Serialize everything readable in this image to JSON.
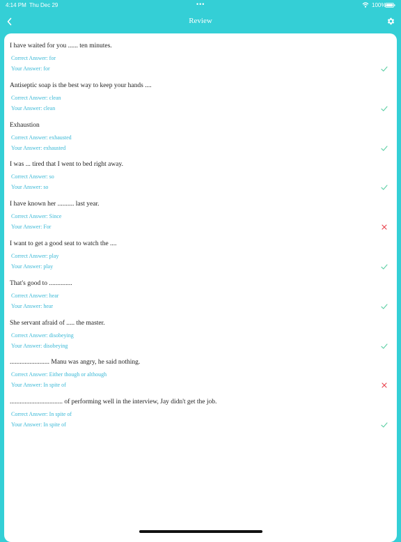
{
  "status_bar": {
    "time": "4:14 PM",
    "date": "Thu Dec 29",
    "dots": "•••",
    "battery": "100%"
  },
  "nav": {
    "title": "Review"
  },
  "colors": {
    "accent": "#34cfd6",
    "answer_text": "#39b8d6",
    "correct": "#5ccfa4",
    "wrong": "#e8404a"
  },
  "labels": {
    "correct_prefix": "Correct Answer: ",
    "your_prefix": "Your Answer: "
  },
  "questions": [
    {
      "question": "I have waited for you ...... ten minutes.",
      "correct": "for",
      "yours": "for",
      "result": "correct"
    },
    {
      "question": "Antiseptic soap is the best way to keep your hands ....",
      "correct": "clean",
      "yours": "clean",
      "result": "correct"
    },
    {
      "question": "Exhaustion",
      "correct": "exhausted",
      "yours": "exhausted",
      "result": "correct"
    },
    {
      "question": "I was ... tired that I went to bed right away.",
      "correct": "so",
      "yours": "so",
      "result": "correct"
    },
    {
      "question": "I have known her .......... last year.",
      "correct": "Since",
      "yours": "For",
      "result": "wrong"
    },
    {
      "question": "I want to get a good seat to watch the ....",
      "correct": "play",
      "yours": "play",
      "result": "correct"
    },
    {
      "question": "That's good to ..............",
      "correct": "hear",
      "yours": "hear",
      "result": "correct"
    },
    {
      "question": "She servant afraid of ..... the master.",
      "correct": "disobeying",
      "yours": "disobeying",
      "result": "correct"
    },
    {
      "question": "........................ Manu was angry, he said nothing.",
      "correct": "Either though or although",
      "yours": "In spite of",
      "result": "wrong"
    },
    {
      "question": "................................ of performing well in the interview, Jay didn't get the job.",
      "correct": "In spite of",
      "yours": "In spite of",
      "result": "correct"
    }
  ]
}
